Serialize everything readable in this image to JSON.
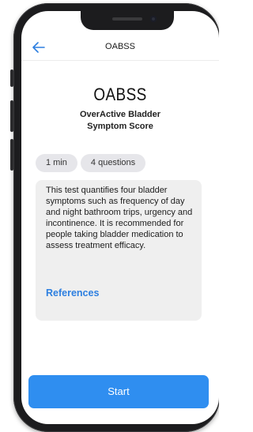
{
  "header": {
    "title": "OABSS",
    "back_icon": "arrow-left-icon"
  },
  "main": {
    "title": "OABSS",
    "subtitle_lines": [
      "OverActive Bladder",
      "Symptom Score"
    ],
    "chips": [
      "1 min",
      "4 questions"
    ],
    "description": "This test quantifies four bladder symptoms such as frequency of day and night bathroom trips, urgency and incontinence. It is recommended for people taking bladder medication to assess treatment efficacy.",
    "references_label": "References"
  },
  "footer": {
    "start_label": "Start"
  },
  "colors": {
    "accent": "#2f8ef0",
    "link": "#2d7fe0",
    "card_bg": "#efefef",
    "chip_bg": "#e6e6ea"
  }
}
